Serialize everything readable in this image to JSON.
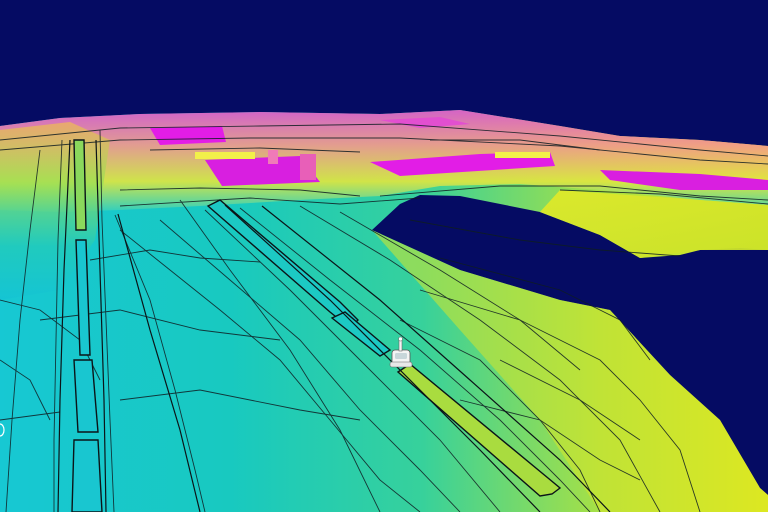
{
  "scene": {
    "colors": {
      "sky": "#050b63",
      "terrain_low": "#12c6d6",
      "terrain_mid": "#2fd4a8",
      "terrain_high": "#e4ec17",
      "elevated": "#f06bc7",
      "peak": "#e21de6",
      "contour": "#101820",
      "vehicle": "#ffffff"
    },
    "icons": {
      "vehicle": "car-icon"
    }
  }
}
